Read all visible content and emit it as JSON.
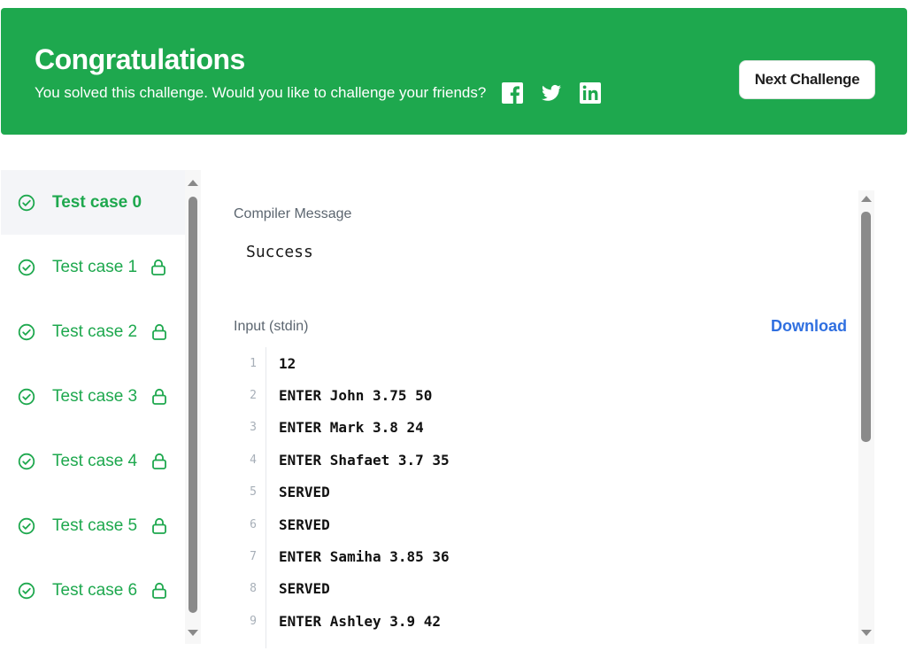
{
  "banner": {
    "title": "Congratulations",
    "subtitle": "You solved this challenge. Would you like to challenge your friends?",
    "social_icons": [
      "facebook-icon",
      "twitter-icon",
      "linkedin-icon"
    ],
    "next_button_label": "Next Challenge",
    "bg_color": "#1ea84e"
  },
  "test_cases": [
    {
      "label": "Test case 0",
      "active": true,
      "locked": false
    },
    {
      "label": "Test case 1",
      "active": false,
      "locked": true
    },
    {
      "label": "Test case 2",
      "active": false,
      "locked": true
    },
    {
      "label": "Test case 3",
      "active": false,
      "locked": true
    },
    {
      "label": "Test case 4",
      "active": false,
      "locked": true
    },
    {
      "label": "Test case 5",
      "active": false,
      "locked": true
    },
    {
      "label": "Test case 6",
      "active": false,
      "locked": true
    }
  ],
  "output": {
    "compiler_label": "Compiler Message",
    "compiler_message": "Success",
    "input_label": "Input (stdin)",
    "download_label": "Download",
    "input_lines": [
      {
        "n": "1",
        "text": "12"
      },
      {
        "n": "2",
        "text": "ENTER John 3.75 50"
      },
      {
        "n": "3",
        "text": "ENTER Mark 3.8 24"
      },
      {
        "n": "4",
        "text": "ENTER Shafaet 3.7 35"
      },
      {
        "n": "5",
        "text": "SERVED"
      },
      {
        "n": "6",
        "text": "SERVED"
      },
      {
        "n": "7",
        "text": "ENTER Samiha 3.85 36"
      },
      {
        "n": "8",
        "text": "SERVED"
      },
      {
        "n": "9",
        "text": "ENTER Ashley 3.9 42"
      }
    ]
  },
  "colors": {
    "accent": "#1ea84e",
    "link": "#2f6fe0"
  }
}
